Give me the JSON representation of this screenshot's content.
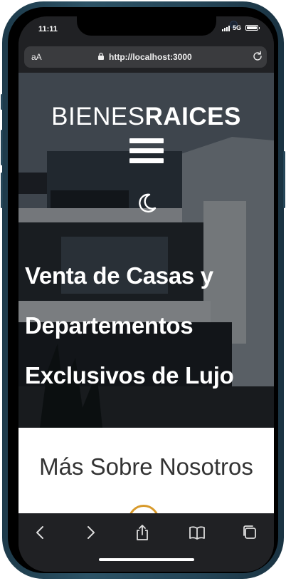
{
  "status": {
    "time": "11:11",
    "network": "5G"
  },
  "browser": {
    "text_size": "aA",
    "url": "http://localhost:3000"
  },
  "header": {
    "logo_light": "BIENES",
    "logo_bold": "RAICES",
    "menu_icon": "hamburger-icon",
    "theme_icon": "moon-icon"
  },
  "hero": {
    "lines": [
      "Venta de Casas y",
      "Departementos",
      "Exclusivos de Lujo"
    ]
  },
  "about": {
    "title": "Más Sobre Nosotros"
  },
  "toolbar": {
    "icons": [
      "back-icon",
      "forward-icon",
      "share-icon",
      "bookmarks-icon",
      "tabs-icon"
    ]
  },
  "colors": {
    "accent": "#d89a2b",
    "browser_chrome": "#202124",
    "phone_frame": "#244557"
  }
}
